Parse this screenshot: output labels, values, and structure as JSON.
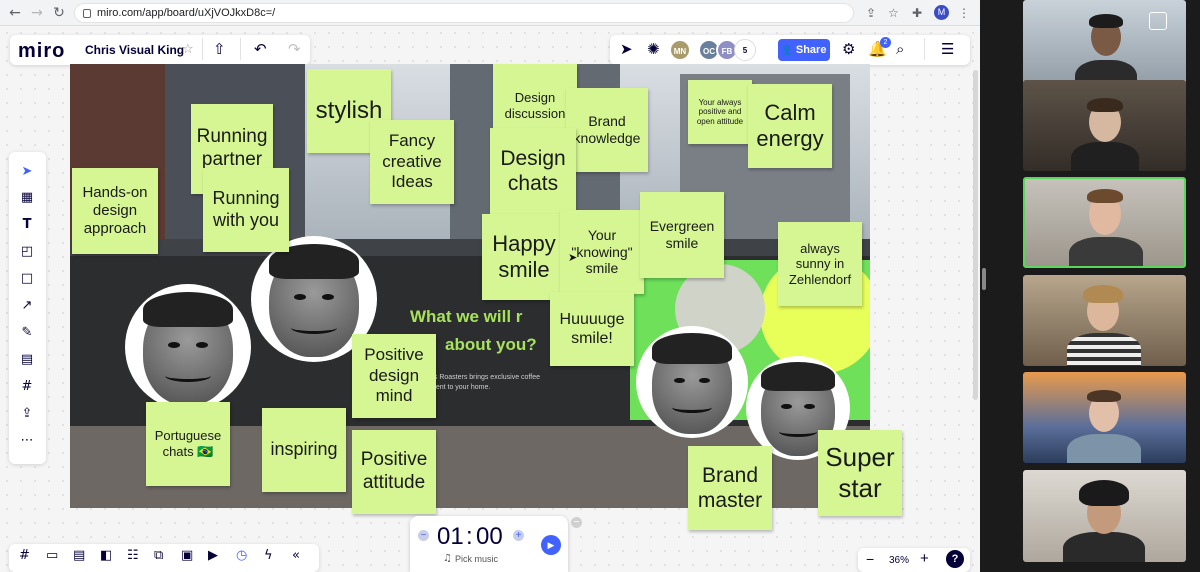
{
  "browser": {
    "url": "miro.com/app/board/uXjVOJkxD8c=/",
    "profile_initial": "M"
  },
  "miro": {
    "logo": "miro",
    "board_title": "Chris Visual King",
    "share_label": "Share",
    "collaborators": [
      "MN",
      "OC",
      "FB"
    ],
    "collaborator_count": "5",
    "notification_count": "2"
  },
  "frame": {
    "headline_1": "What we will r",
    "headline_2": "about you?",
    "small_text_1": "us Roasters brings exclusive coffee",
    "small_text_2": "ment to your home."
  },
  "stickies": [
    {
      "text": "stylish"
    },
    {
      "text": "Running\npartner"
    },
    {
      "text": "Fancy\ncreative\nIdeas"
    },
    {
      "text": "Design\ndiscussion"
    },
    {
      "text": "Brand\nknowledge"
    },
    {
      "text": "Your always\npositive and\nopen attitude"
    },
    {
      "text": "Calm\nenergy"
    },
    {
      "text": "Hands-on\ndesign\napproach"
    },
    {
      "text": "Running\nwith you"
    },
    {
      "text": "Design\nchats"
    },
    {
      "text": "Happy\nsmile"
    },
    {
      "text": "Your\n\"knowing\"\nsmile"
    },
    {
      "text": "Evergreen\nsmile"
    },
    {
      "text": "always\nsunny in\nZehlendorf"
    },
    {
      "text": "Huuuuge\nsmile!"
    },
    {
      "text": "Positive\ndesign\nmind"
    },
    {
      "text": "Portuguese\nchats 🇧🇷"
    },
    {
      "text": "inspiring"
    },
    {
      "text": "Positive\nattitude"
    },
    {
      "text": "Brand\nmaster"
    },
    {
      "text": "Super\nstar"
    }
  ],
  "timer": {
    "minutes": "01",
    "seconds": "00",
    "separator": ":",
    "pick_music": "Pick music"
  },
  "zoom": {
    "level": "36%",
    "minus": "−",
    "plus": "+",
    "help": "?"
  },
  "colors": {
    "sticky": "#d5f692",
    "accent": "#4262ff",
    "active_speaker": "#5ad75a"
  }
}
